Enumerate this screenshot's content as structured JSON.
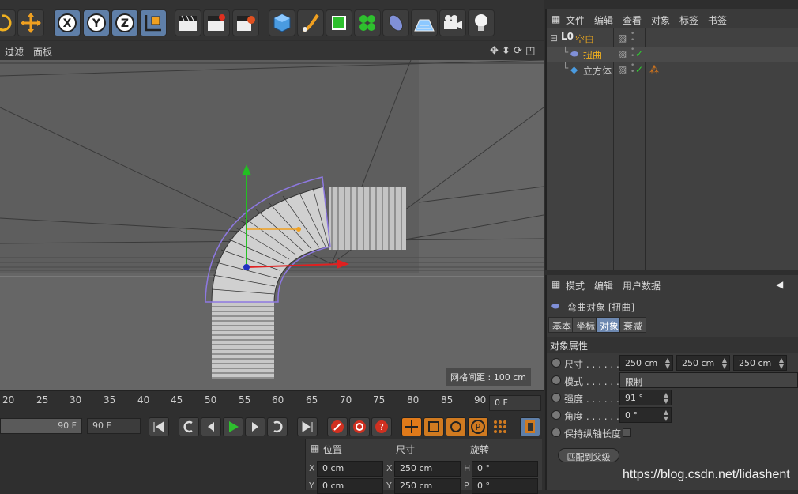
{
  "viewport_menu": {
    "filter": "过滤",
    "panel": "面板"
  },
  "viewport": {
    "grid_spacing": "网格间距 : 100 cm"
  },
  "timeline": {
    "ticks": [
      "20",
      "25",
      "30",
      "35",
      "40",
      "45",
      "50",
      "55",
      "60",
      "65",
      "70",
      "75",
      "80",
      "85",
      "90"
    ],
    "current_frame": "0 F"
  },
  "transport": {
    "end_frame": "90 F",
    "max_frame": "90 F"
  },
  "coords": {
    "headers": {
      "position": "位置",
      "size": "尺寸",
      "rotation": "旋转"
    },
    "axis": {
      "x": "X",
      "y": "Y",
      "h": "H",
      "p": "P"
    },
    "pos_x": "0 cm",
    "pos_y": "0 cm",
    "size_x": "250 cm",
    "size_y": "250 cm",
    "rot_h": "0 °",
    "rot_p": "0 °"
  },
  "object_manager": {
    "menu": [
      "文件",
      "编辑",
      "查看",
      "对象",
      "标签",
      "书签"
    ],
    "objects": [
      {
        "name": "空白",
        "icon": "null-icon",
        "color": "#e0a020"
      },
      {
        "name": "扭曲",
        "icon": "bend-deformer-icon",
        "color": "#f0b020"
      },
      {
        "name": "立方体",
        "icon": "cube-icon",
        "color": "#c8c8c8"
      }
    ]
  },
  "attributes": {
    "menu": [
      "模式",
      "编辑",
      "用户数据"
    ],
    "object_title": "弯曲对象 [扭曲]",
    "tabs": [
      "基本",
      "坐标",
      "对象",
      "衰减"
    ],
    "section": "对象属性",
    "size_label": "尺寸 . . . . . . . .",
    "size_values": [
      "250 cm",
      "250 cm",
      "250 cm"
    ],
    "mode_label": "模式 . . . . . . . .",
    "mode_value": "限制",
    "strength_label": "强度 . . . . . . . .",
    "strength_value": "91 °",
    "angle_label": "角度 . . . . . . . .",
    "angle_value": "0 °",
    "keep_axis_label": "保持纵轴长度",
    "match_parent_button": "匹配到父级"
  },
  "watermark": "https://blog.csdn.net/lidashent",
  "colors": {
    "accent_blue": "#5f7fa8",
    "play_green": "#2ec02e",
    "record_red": "#d03020",
    "selected_tab": "#6d88b0",
    "axis_y": "#22c022",
    "axis_x": "#e02020",
    "deformer_cage": "#8d78e0"
  }
}
